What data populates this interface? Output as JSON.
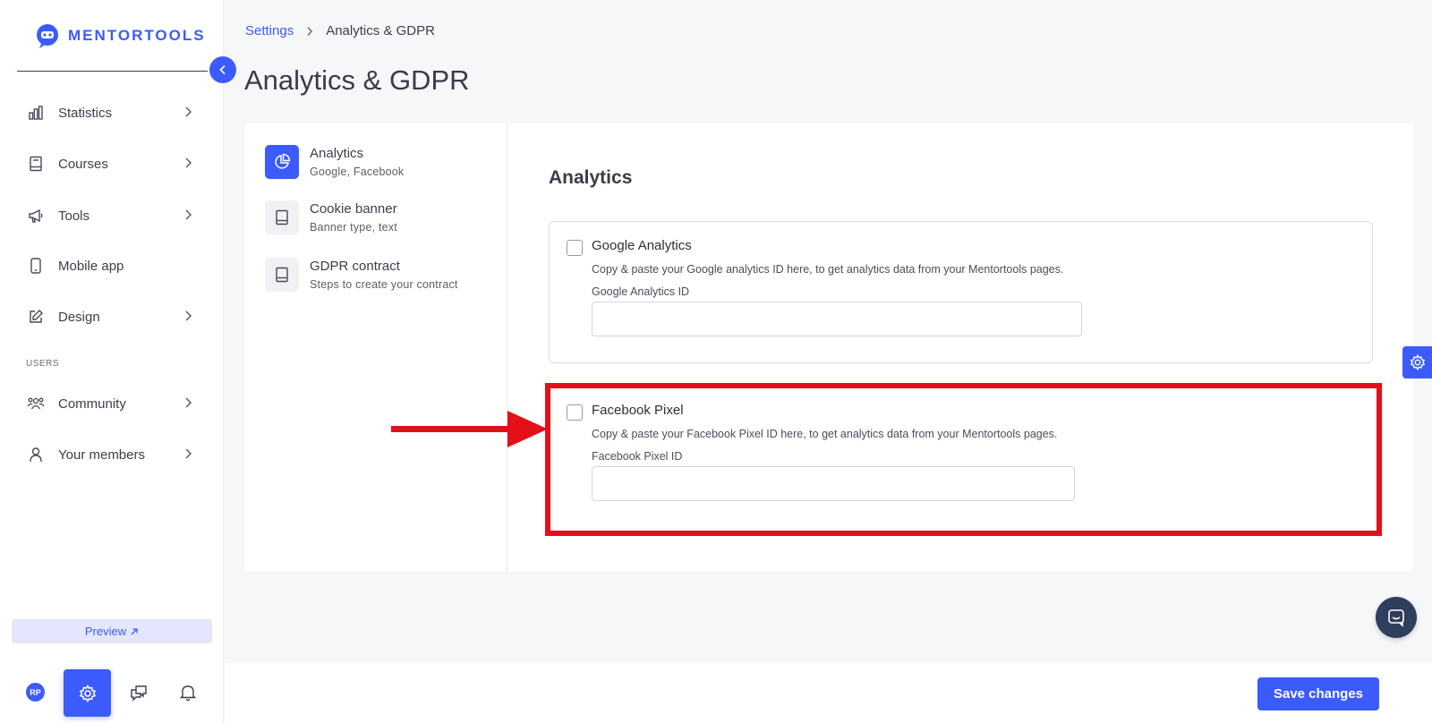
{
  "app": {
    "brand": "MENTORTOOLS",
    "accent": "#3b5bfd",
    "highlight": "#e3101a"
  },
  "sidebar": {
    "items": [
      {
        "label": "Statistics",
        "icon": "bar-chart-icon",
        "has_chevron": true
      },
      {
        "label": "Courses",
        "icon": "book-icon",
        "has_chevron": true
      },
      {
        "label": "Tools",
        "icon": "megaphone-icon",
        "has_chevron": true
      },
      {
        "label": "Mobile app",
        "icon": "mobile-icon",
        "has_chevron": false
      },
      {
        "label": "Design",
        "icon": "pencil-icon",
        "has_chevron": true
      }
    ],
    "section_label": "USERS",
    "user_items": [
      {
        "label": "Community",
        "icon": "people-icon",
        "has_chevron": true
      },
      {
        "label": "Your members",
        "icon": "user-icon",
        "has_chevron": true
      }
    ],
    "preview_label": "Preview",
    "avatar_initials": "RP"
  },
  "breadcrumb": {
    "parent": "Settings",
    "current": "Analytics & GDPR"
  },
  "page_title": "Analytics & GDPR",
  "subnav": [
    {
      "title": "Analytics",
      "subtitle": "Google, Facebook",
      "active": true
    },
    {
      "title": "Cookie banner",
      "subtitle": "Banner type, text",
      "active": false
    },
    {
      "title": "GDPR contract",
      "subtitle": "Steps to create your contract",
      "active": false
    }
  ],
  "section_title": "Analytics",
  "settings": {
    "google": {
      "title": "Google Analytics",
      "description": "Copy & paste your Google analytics ID here, to get analytics data from your Mentortools pages.",
      "field_label": "Google Analytics ID",
      "value": "",
      "checked": false
    },
    "facebook": {
      "title": "Facebook Pixel",
      "description": "Copy & paste your Facebook Pixel ID here, to get analytics data from your Mentortools pages.",
      "field_label": "Facebook Pixel ID",
      "value": "",
      "checked": false
    }
  },
  "footer": {
    "save_label": "Save changes"
  }
}
